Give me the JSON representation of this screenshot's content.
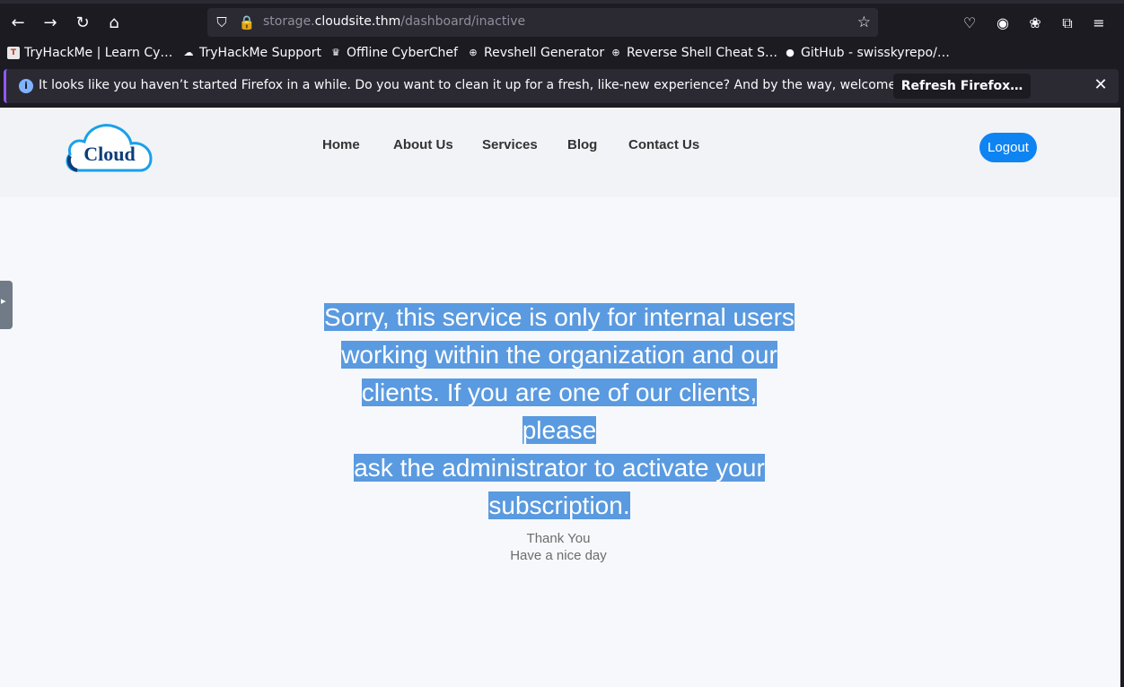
{
  "browser": {
    "url_prefix": "storage.",
    "url_host": "cloudsite.thm",
    "url_path": "/dashboard/inactive",
    "bookmarks": [
      {
        "label": "TryHackMe | Learn Cy…"
      },
      {
        "label": "TryHackMe Support"
      },
      {
        "label": "Offline CyberChef"
      },
      {
        "label": "Revshell Generator"
      },
      {
        "label": "Reverse Shell Cheat S…"
      },
      {
        "label": "GitHub - swisskyrepo/…"
      }
    ],
    "notice_text": "It looks like you haven’t started Firefox in a while. Do you want to clean it up for a fresh, like-new experience? And by the way, welcome back!",
    "notice_button": "Refresh Firefox…"
  },
  "site": {
    "logo_text": "Cloud",
    "nav": [
      "Home",
      "About Us",
      "Services",
      "Blog",
      "Contact Us"
    ],
    "logout_label": "Logout",
    "message_lines": [
      "Sorry, this service is only for internal users",
      "working within the organization and our",
      "clients. If you are one of our clients, please",
      "ask the administrator to activate your",
      "subscription."
    ],
    "thanks_line1": "Thank You",
    "thanks_line2": "Have a nice day"
  },
  "colors": {
    "accent": "#0d84f2",
    "selection": "#5a9ae0",
    "browser_bg": "#1c1b22"
  }
}
